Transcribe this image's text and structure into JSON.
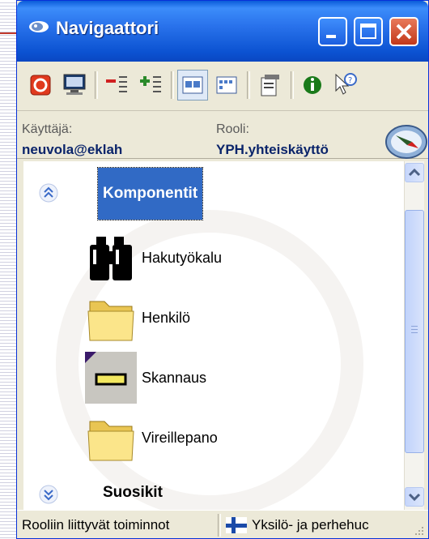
{
  "window": {
    "title": "Navigaattori"
  },
  "toolbar": {
    "buttons": [
      {
        "icon": "power-off-icon"
      },
      {
        "icon": "monitor-icon"
      },
      {
        "icon": "collapse-icon"
      },
      {
        "icon": "expand-icon"
      },
      {
        "icon": "large-icons-view-icon",
        "active": true
      },
      {
        "icon": "small-icons-view-icon"
      },
      {
        "icon": "properties-icon"
      },
      {
        "icon": "info-icon"
      },
      {
        "icon": "help-pointer-icon"
      }
    ]
  },
  "user": {
    "user_label": "Käyttäjä:",
    "user_value": "neuvola@eklah",
    "role_label": "Rooli:",
    "role_value": "YPH.yhteiskäyttö"
  },
  "groups": [
    {
      "label": "Komponentit",
      "expanded": true,
      "items": [
        {
          "label": "Hakutyökalu",
          "icon": "binoculars-icon"
        },
        {
          "label": "Henkilö",
          "icon": "folder-icon"
        },
        {
          "label": "Skannaus",
          "icon": "scanner-icon"
        },
        {
          "label": "Vireillepano",
          "icon": "folder-icon"
        }
      ]
    },
    {
      "label": "Suosikit",
      "expanded": false
    }
  ],
  "status": {
    "left": "Rooliin liittyvät toiminnot",
    "right": "Yksilö- ja perhehuc"
  },
  "colors": {
    "titlebar": "#0b52d1",
    "selection": "#316ac5",
    "chrome": "#ece9d8"
  }
}
